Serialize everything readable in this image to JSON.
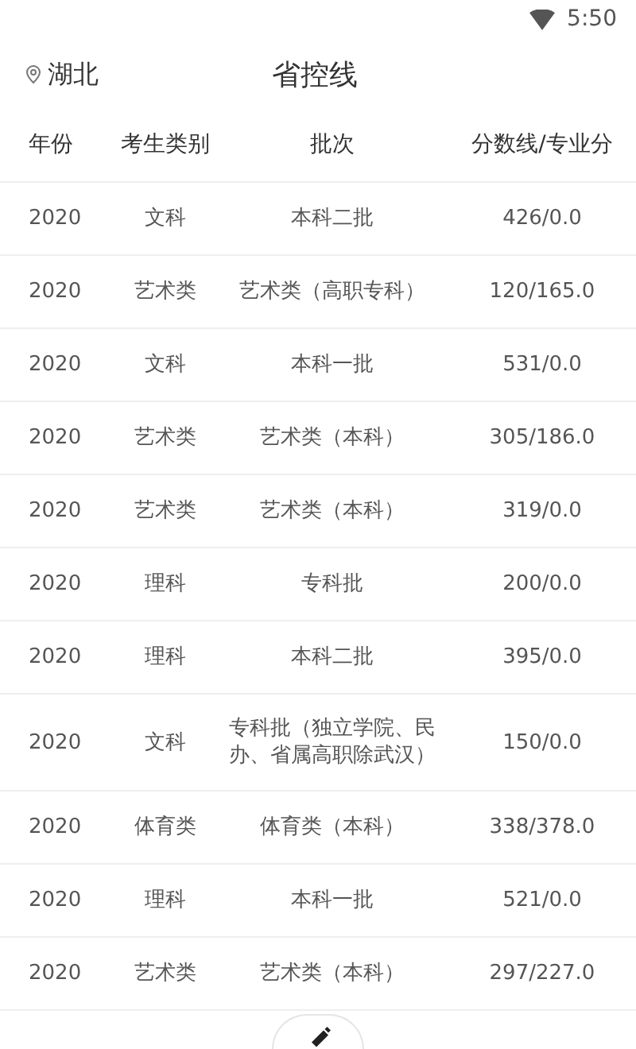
{
  "status_bar": {
    "time": "5:50"
  },
  "header": {
    "location": "湖北",
    "title": "省控线"
  },
  "table": {
    "columns": [
      "年份",
      "考生类别",
      "批次",
      "分数线/专业分"
    ],
    "rows": [
      [
        "2020",
        "文科",
        "本科二批",
        "426/0.0"
      ],
      [
        "2020",
        "艺术类",
        "艺术类（高职专科）",
        "120/165.0"
      ],
      [
        "2020",
        "文科",
        "本科一批",
        "531/0.0"
      ],
      [
        "2020",
        "艺术类",
        "艺术类（本科）",
        "305/186.0"
      ],
      [
        "2020",
        "艺术类",
        "艺术类（本科）",
        "319/0.0"
      ],
      [
        "2020",
        "理科",
        "专科批",
        "200/0.0"
      ],
      [
        "2020",
        "理科",
        "本科二批",
        "395/0.0"
      ],
      [
        "2020",
        "文科",
        "专科批（独立学院、民办、省属高职除武汉）",
        "150/0.0"
      ],
      [
        "2020",
        "体育类",
        "体育类（本科）",
        "338/378.0"
      ],
      [
        "2020",
        "理科",
        "本科一批",
        "521/0.0"
      ],
      [
        "2020",
        "艺术类",
        "艺术类（本科）",
        "297/227.0"
      ]
    ]
  }
}
